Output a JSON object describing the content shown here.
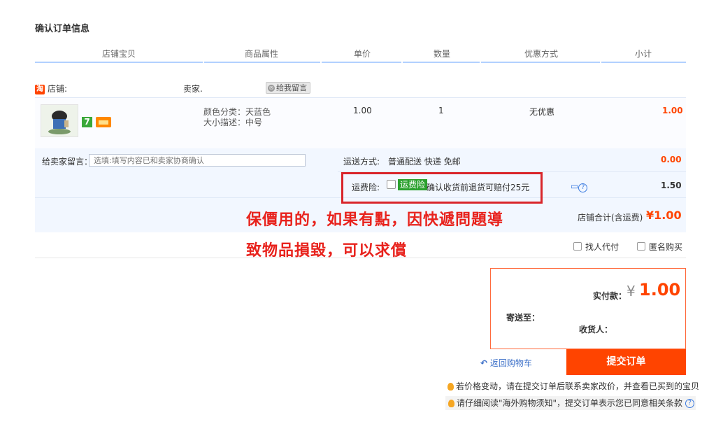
{
  "title": "确认订单信息",
  "columns": [
    "店铺宝贝",
    "商品属性",
    "单价",
    "数量",
    "优惠方式",
    "小计"
  ],
  "shop": {
    "label": "店铺:",
    "seller_label": "卖家.",
    "icon_text": "淘",
    "message_btn": "给我留言"
  },
  "item": {
    "badge": "7",
    "attr_color": "颜色分类：天蓝色",
    "attr_size": "大小描述：中号",
    "unit_price": "1.00",
    "quantity": "1",
    "discount": "无优惠",
    "subtotal": "1.00"
  },
  "note": {
    "label": "给卖家留言：",
    "placeholder": "选填:填写内容已和卖家协商确认"
  },
  "shipping": {
    "label": "运送方式:",
    "value": "普通配送 快递 免邮",
    "price": "0.00"
  },
  "insurance": {
    "label": "运费险:",
    "tag": "运费险",
    "desc": "确认收货前退货可赔付25元",
    "price": "1.50"
  },
  "annotation": {
    "line1": "保價用的，如果有點，因快遞問題導",
    "line2": "致物品損毀，可以求償"
  },
  "shop_total": {
    "label": "店铺合计(含运费)",
    "value": "¥1.00"
  },
  "options": {
    "proxy_pay": "找人代付",
    "anonymous": "匿名购买"
  },
  "payment": {
    "label": "实付款：",
    "currency": "¥",
    "amount": "1.00",
    "ship_to": "寄送至：",
    "receiver": "收货人："
  },
  "actions": {
    "back": "返回购物车",
    "submit": "提交订单"
  },
  "tips": {
    "price_change": "若价格变动，请在提交订单后联系卖家改价，并查看已买到的宝贝",
    "read_notice": "请仔细阅读\"海外购物须知\"，提交订单表示您已同意相关条款"
  },
  "colors": {
    "accent": "#ff4400",
    "annotation": "#e8221c",
    "panel": "#f2f7ff",
    "header_line": "#b2d1ff"
  }
}
